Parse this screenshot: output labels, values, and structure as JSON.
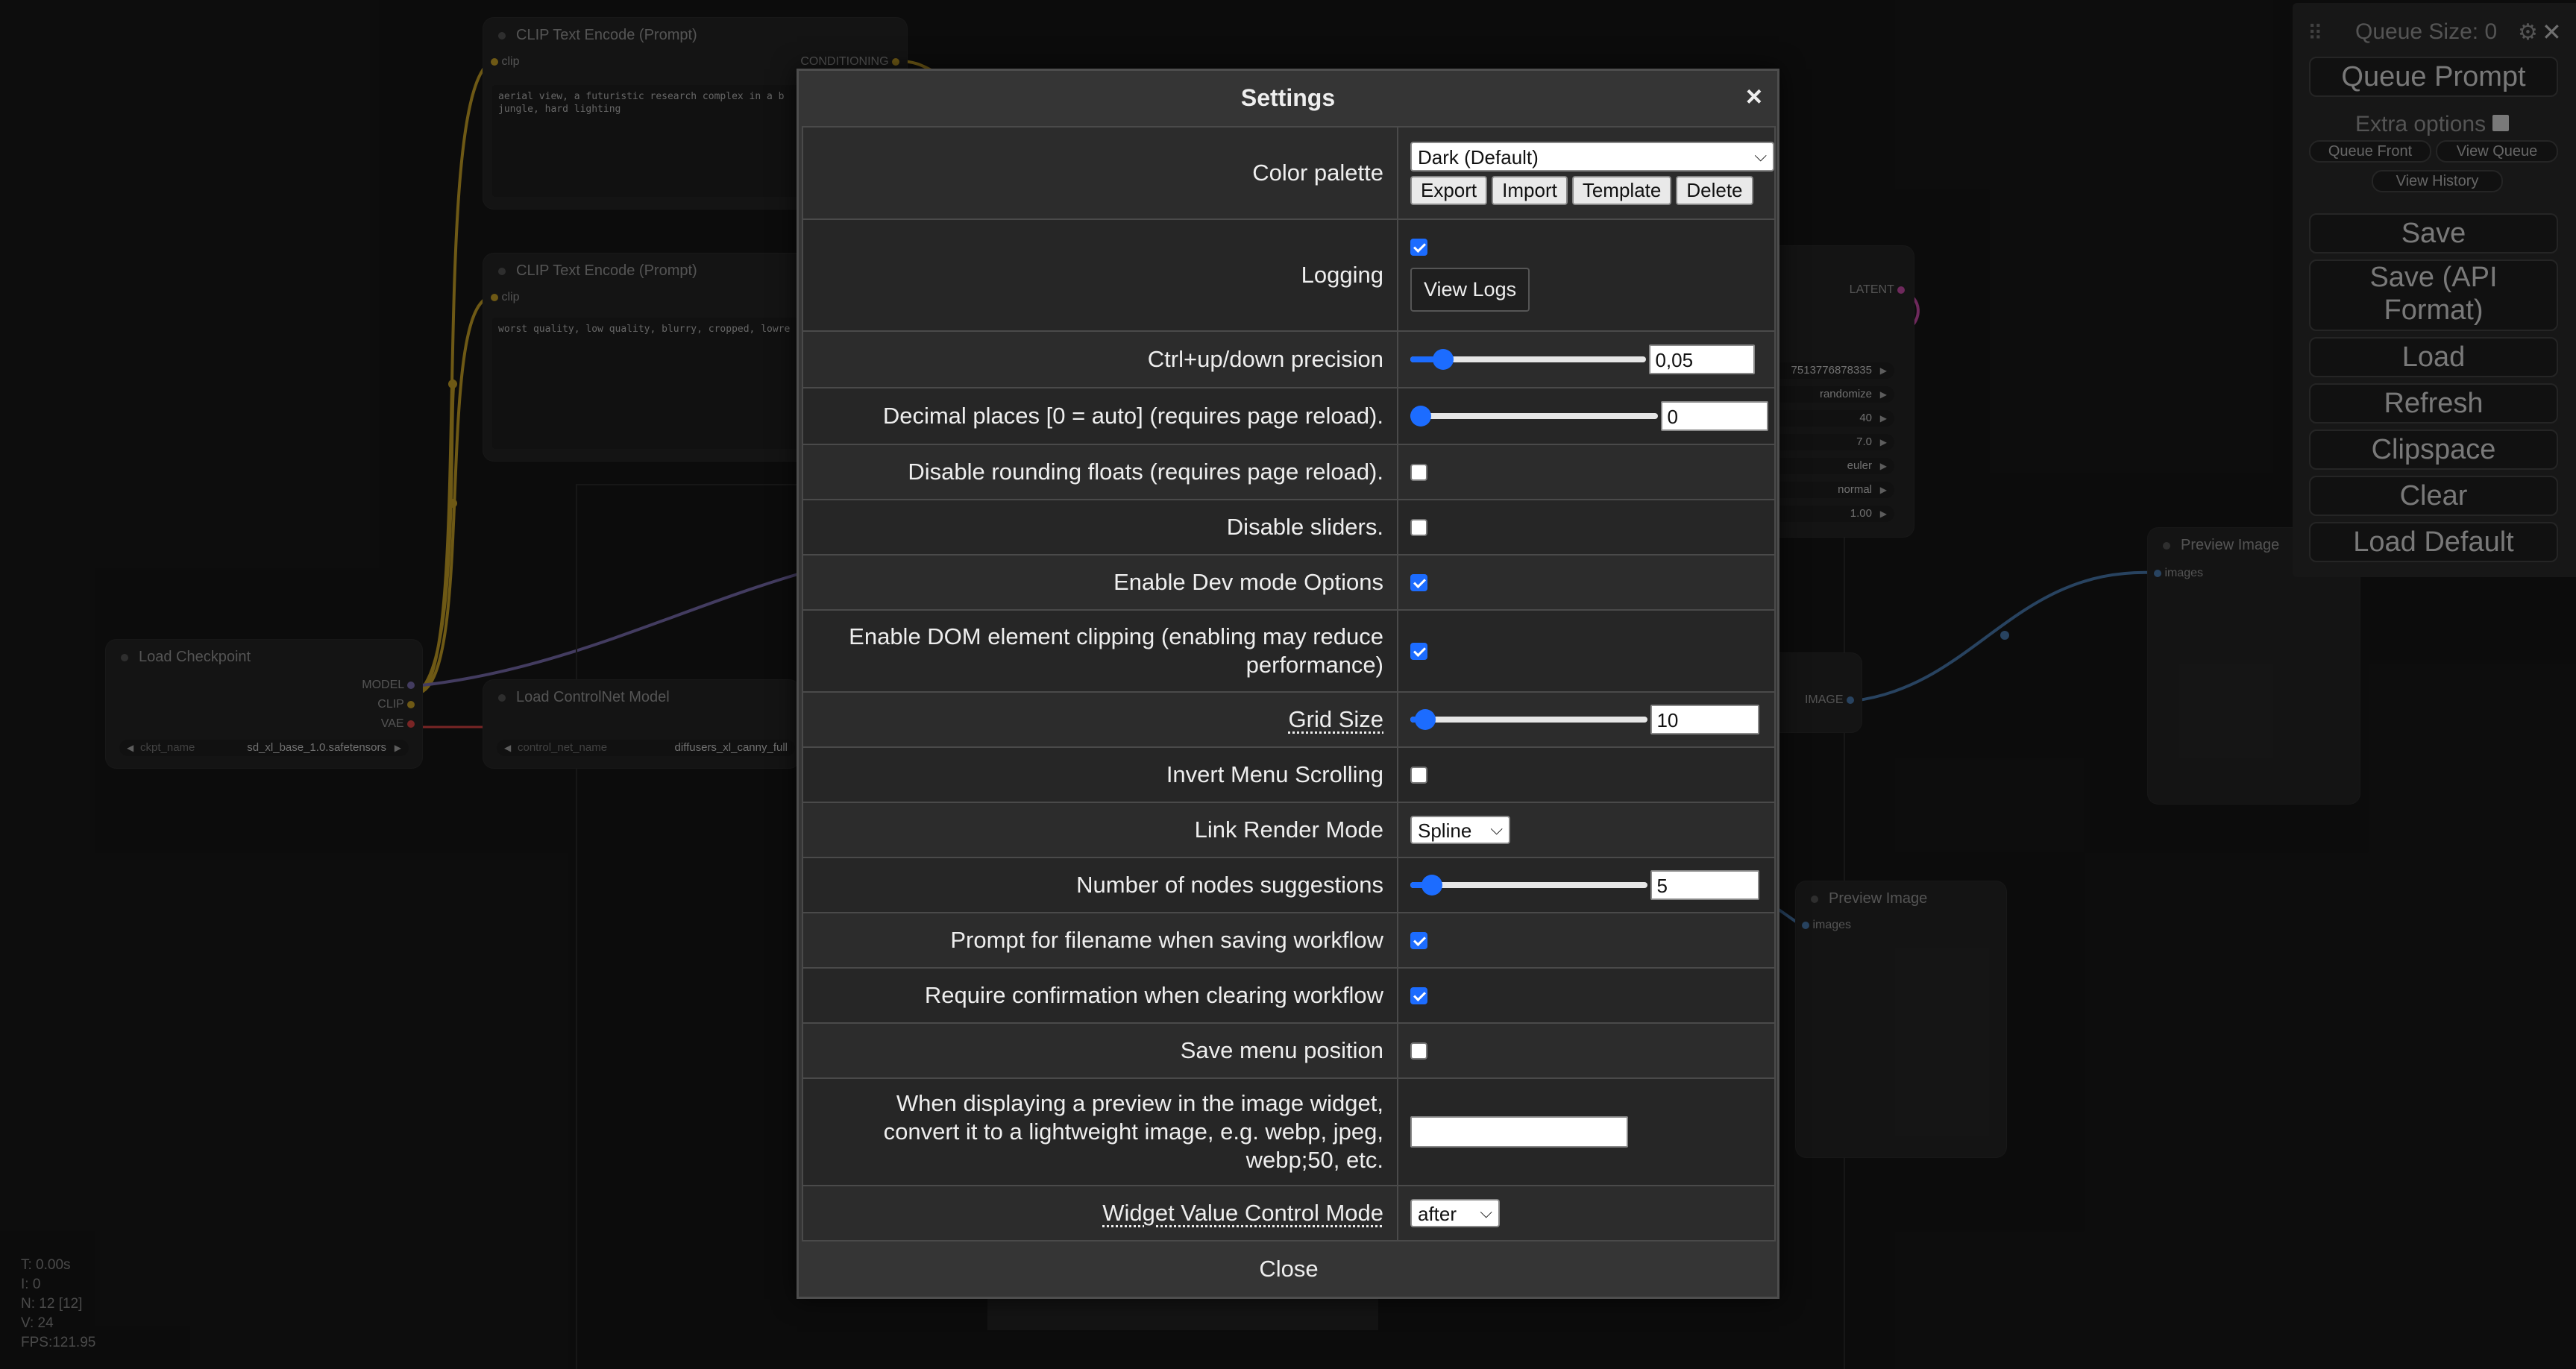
{
  "graph": {
    "nodes": {
      "clip1": {
        "title": "CLIP Text Encode (Prompt)",
        "input": "clip",
        "output": "CONDITIONING",
        "text": "aerial view, a futuristic research complex in a b\njungle, hard lighting"
      },
      "clip2": {
        "title": "CLIP Text Encode (Prompt)",
        "input": "clip",
        "text": "worst quality, low quality, blurry, cropped, lowre"
      },
      "checkpoint": {
        "title": "Load Checkpoint",
        "outputs": [
          "MODEL",
          "CLIP",
          "VAE"
        ],
        "widget_label": "ckpt_name",
        "widget_value": "sd_xl_base_1.0.safetensors"
      },
      "controlnet": {
        "title": "Load ControlNet Model",
        "widget_label": "control_net_name",
        "widget_value": "diffusers_xl_canny_full"
      },
      "sampler": {
        "output": "LATENT",
        "values": [
          "7513776878335",
          "randomize",
          "40",
          "7.0",
          "euler",
          "normal",
          "1.00"
        ]
      },
      "decode": {
        "output": "IMAGE"
      },
      "preview1": {
        "title": "Preview Image",
        "input": "images"
      },
      "preview2": {
        "title": "Preview Image",
        "input": "images"
      }
    }
  },
  "stats": [
    "T: 0.00s",
    "I: 0",
    "N: 12 [12]",
    "V: 24",
    "FPS:121.95"
  ],
  "menu": {
    "queue_size": "Queue Size: 0",
    "queue_prompt": "Queue Prompt",
    "extra_options": "Extra options",
    "queue_front": "Queue Front",
    "view_queue": "View Queue",
    "view_history": "View History",
    "buttons": [
      "Save",
      "Save (API\nFormat)",
      "Load",
      "Refresh",
      "Clipspace",
      "Clear",
      "Load Default"
    ]
  },
  "settings": {
    "title": "Settings",
    "close_x": "×",
    "close": "Close",
    "color_palette": {
      "label": "Color palette",
      "value": "Dark (Default)",
      "buttons": [
        "Export",
        "Import",
        "Template",
        "Delete"
      ]
    },
    "logging": {
      "label": "Logging",
      "checked": true,
      "button": "View Logs"
    },
    "precision": {
      "label": "Ctrl+up/down precision",
      "value": "0,05",
      "fraction": 0.1
    },
    "decimal_places": {
      "label": "Decimal places [0 = auto] (requires page reload).",
      "value": "0",
      "fraction": 0.0
    },
    "disable_rounding": {
      "label": "Disable rounding floats (requires page reload).",
      "checked": false
    },
    "disable_sliders": {
      "label": "Disable sliders.",
      "checked": false
    },
    "dev_mode": {
      "label": "Enable Dev mode Options",
      "checked": true
    },
    "dom_clipping": {
      "label": "Enable DOM element clipping (enabling may reduce performance)",
      "checked": true
    },
    "grid_size": {
      "label": "Grid Size",
      "value": "10",
      "fraction": 0.02
    },
    "invert_scrolling": {
      "label": "Invert Menu Scrolling",
      "checked": false
    },
    "link_render": {
      "label": "Link Render Mode",
      "value": "Spline"
    },
    "node_suggestions": {
      "label": "Number of nodes suggestions",
      "value": "5",
      "fraction": 0.05
    },
    "prompt_filename": {
      "label": "Prompt for filename when saving workflow",
      "checked": true
    },
    "confirm_clear": {
      "label": "Require confirmation when clearing workflow",
      "checked": true
    },
    "save_menu_pos": {
      "label": "Save menu position",
      "checked": false
    },
    "preview_convert": {
      "label": "When displaying a preview in the image widget, convert it to a lightweight image, e.g. webp, jpeg, webp;50, etc.",
      "value": ""
    },
    "widget_control": {
      "label": "Widget Value Control Mode",
      "value": "after"
    }
  }
}
